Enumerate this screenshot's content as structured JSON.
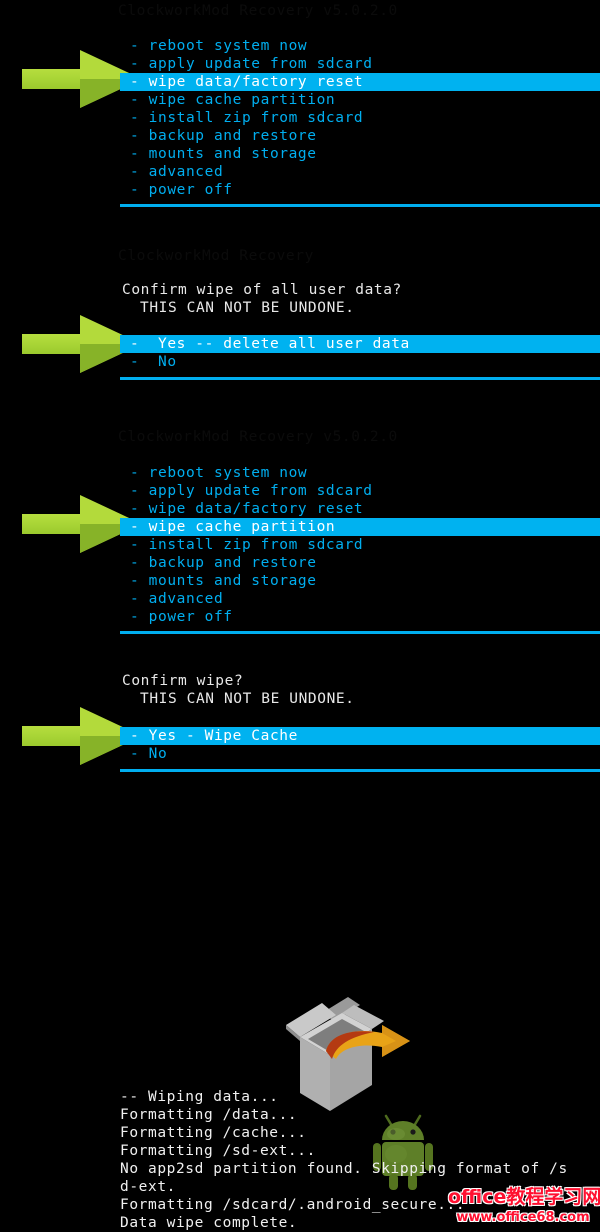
{
  "screen": {
    "background_color": "#000000",
    "menu_text_color": "#00AEEF",
    "highlight_bg_color": "#00B2F0",
    "highlight_text_color": "#FFFFFF",
    "prompt_text_color": "#E8E8E8",
    "arrow_color": "#AAD637",
    "watermark_color": "#FF1030"
  },
  "panel1": {
    "faded_header": "ClockworkMod Recovery v5.0.2.0",
    "items": [
      {
        "label": "- reboot system now",
        "selected": false
      },
      {
        "label": "- apply update from sdcard",
        "selected": false
      },
      {
        "label": "- wipe data/factory reset",
        "selected": true
      },
      {
        "label": "- wipe cache partition",
        "selected": false
      },
      {
        "label": "- install zip from sdcard",
        "selected": false
      },
      {
        "label": "- backup and restore",
        "selected": false
      },
      {
        "label": "- mounts and storage",
        "selected": false
      },
      {
        "label": "- advanced",
        "selected": false
      },
      {
        "label": "- power off",
        "selected": false
      }
    ]
  },
  "panel2": {
    "faded_header": "ClockworkMod Recovery",
    "question": "Confirm wipe of all user data?",
    "warning": "THIS CAN NOT BE UNDONE.",
    "items": [
      {
        "label": "-  Yes -- delete all user data",
        "selected": true
      },
      {
        "label": "-  No",
        "selected": false
      }
    ]
  },
  "panel3": {
    "faded_header": "ClockworkMod Recovery v5.0.2.0",
    "items": [
      {
        "label": "- reboot system now",
        "selected": false
      },
      {
        "label": "- apply update from sdcard",
        "selected": false
      },
      {
        "label": "- wipe data/factory reset",
        "selected": false
      },
      {
        "label": "- wipe cache partition",
        "selected": true
      },
      {
        "label": "- install zip from sdcard",
        "selected": false
      },
      {
        "label": "- backup and restore",
        "selected": false
      },
      {
        "label": "- mounts and storage",
        "selected": false
      },
      {
        "label": "- advanced",
        "selected": false
      },
      {
        "label": "- power off",
        "selected": false
      }
    ]
  },
  "panel4": {
    "question": "Confirm wipe?",
    "warning": "THIS CAN NOT BE UNDONE.",
    "items": [
      {
        "label": "- Yes - Wipe Cache",
        "selected": true
      },
      {
        "label": "- No",
        "selected": false
      }
    ]
  },
  "log": {
    "lines": [
      "-- Wiping data...",
      "Formatting /data...",
      "Formatting /cache...",
      "Formatting /sd-ext...",
      "No app2sd partition found. Skipping format of /s",
      "d-ext.",
      "Formatting /sdcard/.android_secure...",
      "Data wipe complete."
    ]
  },
  "graphics": {
    "box_icon": "open-box-with-arrow-icon",
    "robot_icon": "android-robot-icon",
    "arrow_icon": "green-selector-arrow-icon"
  },
  "watermark": {
    "line1": "office教程学习网",
    "line2": "www.office68.com"
  }
}
